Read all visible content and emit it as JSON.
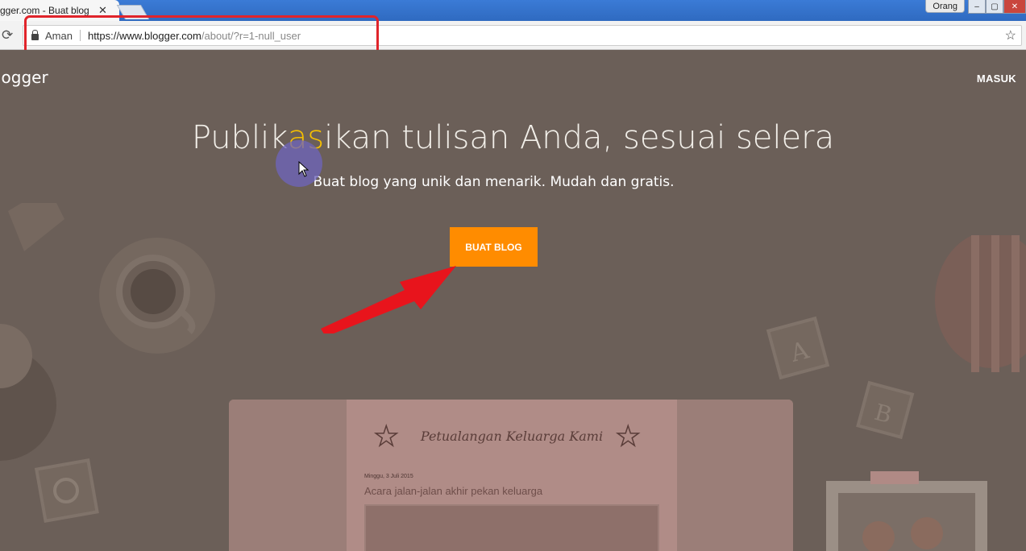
{
  "browser": {
    "tab_title": "gger.com - Buat blog",
    "tab_close": "✕",
    "user_badge": "Orang",
    "reload_icon": "reload-icon",
    "secure_label": "Aman",
    "url_host": "https://www.blogger.com",
    "url_path": "/about/?r=1-null_user",
    "bookmark_icon": "star-icon",
    "window_controls": [
      "–",
      "▢",
      "✕"
    ]
  },
  "page": {
    "brand": "logger",
    "signin_label": "MASUK",
    "headline_pre": "Publik",
    "headline_highlight": "as",
    "headline_post": "ikan tulisan Anda, sesuai selera",
    "subline": "Buat blog yang unik dan menarik. Mudah dan gratis.",
    "cta_label": "BUAT BLOG",
    "preview": {
      "blog_title": "Petualangan Keluarga Kami",
      "post_date": "Minggu, 3 Juli 2015",
      "post_title": "Acara jalan-jalan akhir pekan keluarga"
    }
  },
  "colors": {
    "page_bg": "#6b5f58",
    "cta": "#ff8c00",
    "highlight": "#f6c000",
    "annotation": "#e0242b"
  }
}
